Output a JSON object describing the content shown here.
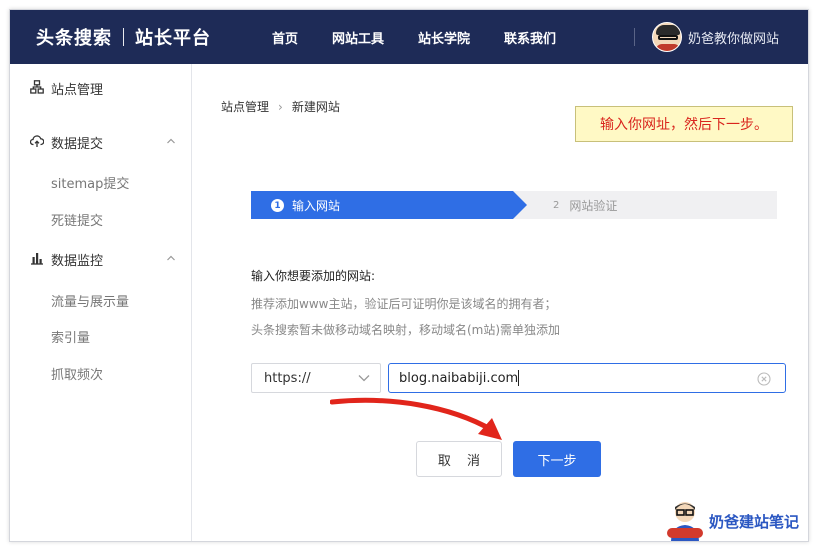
{
  "header": {
    "brand": "头条搜索",
    "platform": "站长平台",
    "nav": [
      "首页",
      "网站工具",
      "站长学院",
      "联系我们"
    ],
    "user_name": "奶爸教你做网站"
  },
  "sidebar": {
    "site_manage": "站点管理",
    "data_submit": "数据提交",
    "submit_items": [
      "sitemap提交",
      "死链提交"
    ],
    "data_monitor": "数据监控",
    "monitor_items": [
      "流量与展示量",
      "索引量",
      "抓取频次"
    ]
  },
  "breadcrumb": {
    "root": "站点管理",
    "current": "新建网站"
  },
  "tip": "输入你网址，然后下一步。",
  "steps": [
    {
      "num": "1",
      "label": "输入网站"
    },
    {
      "num": "2",
      "label": "网站验证"
    }
  ],
  "form": {
    "title": "输入你想要添加的网站:",
    "hint1": "推荐添加www主站，验证后可证明你是该域名的拥有者；",
    "hint2": "头条搜索暂未做移动域名映射，移动域名(m站)需单独添加",
    "protocol": "https://",
    "url_value": "blog.naibabiji.com"
  },
  "buttons": {
    "cancel": "取 消",
    "next": "下一步"
  },
  "watermark": "奶爸建站笔记",
  "colors": {
    "header_bg": "#1e2b57",
    "primary": "#2f6ee5",
    "tip_bg": "#fff9c5",
    "tip_text": "#d9251d",
    "arrow": "#e1251b"
  }
}
